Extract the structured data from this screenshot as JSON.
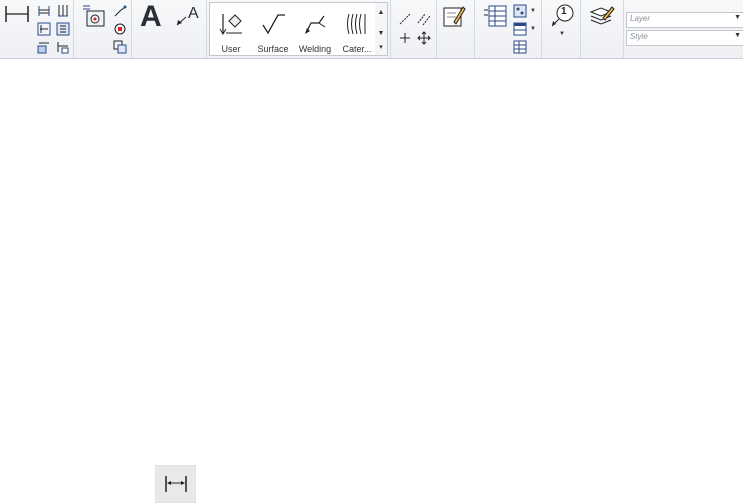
{
  "ribbon": {
    "gallery": {
      "items": [
        {
          "label": "User",
          "icon": "user-marker-icon"
        },
        {
          "label": "Surface",
          "icon": "surface-finish-icon"
        },
        {
          "label": "Welding",
          "icon": "welding-symbol-icon"
        },
        {
          "label": "Cater...",
          "icon": "caterpillar-icon"
        }
      ]
    },
    "layer_combo": {
      "placeholder": "Layer"
    },
    "style_combo": {
      "placeholder": "Style"
    },
    "balloon_number": "1",
    "text_icon_glyph": "A",
    "leader_text_glyph": "A"
  }
}
